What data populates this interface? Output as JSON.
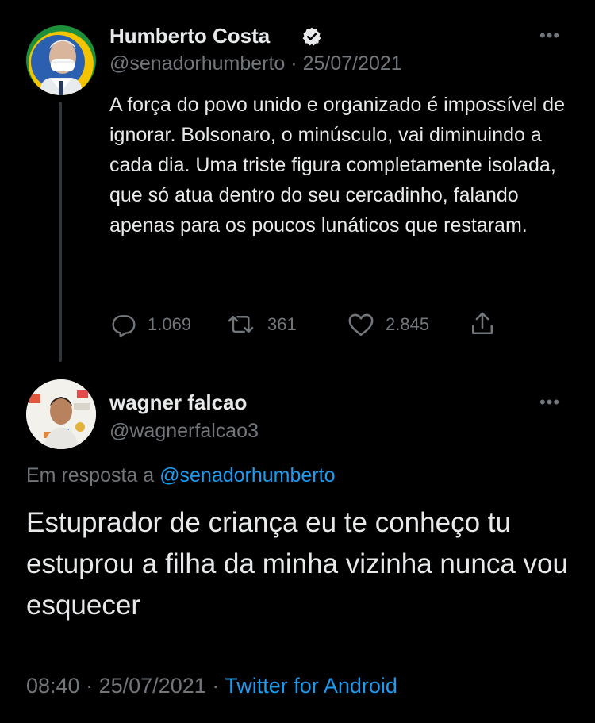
{
  "tweet1": {
    "name": "Humberto Costa",
    "handle": "@senadorhumberto",
    "separator": "·",
    "date": "25/07/2021",
    "text": "A força do povo unido e organizado é impossível de ignorar. Bolsonaro, o minúsculo, vai diminuindo a cada dia. Uma triste figura completamente isolada, que só atua dentro do seu cercadinho, falando apenas para os poucos lunáticos que restaram.",
    "replies": "1.069",
    "retweets": "361",
    "likes": "2.845",
    "verified": true
  },
  "tweet2": {
    "name": "wagner falcao",
    "handle": "@wagnerfalcao3",
    "reply_prefix": "Em resposta a",
    "reply_handle": "@senadorhumberto",
    "text": "Estuprador de criança eu te conheço tu estuprou a filha da minha vizinha nunca vou esquecer",
    "time": "08:40",
    "separator": "·",
    "date": "25/07/2021",
    "source": "Twitter for Android"
  },
  "colors": {
    "background": "#000000",
    "text": "#e7e9ea",
    "muted": "#71767b",
    "link": "#1d9bf0"
  },
  "icons": [
    "more-icon",
    "verified-badge-icon",
    "reply-icon",
    "retweet-icon",
    "like-icon",
    "share-icon"
  ]
}
